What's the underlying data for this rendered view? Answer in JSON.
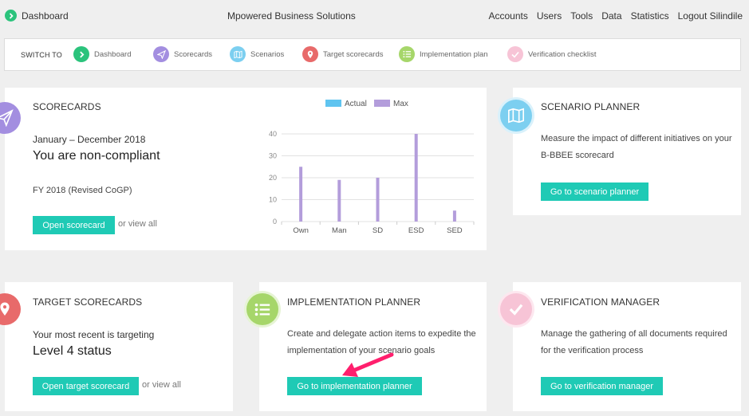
{
  "topbar": {
    "brand_label": "Dashboard",
    "company": "Mpowered Business Solutions",
    "nav": [
      "Accounts",
      "Users",
      "Tools",
      "Data",
      "Statistics",
      "Logout Silindile"
    ]
  },
  "switchbar": {
    "label": "SWITCH TO",
    "items": [
      {
        "label": "Dashboard",
        "icon": "chevron-right-icon",
        "color": "#2bc37c"
      },
      {
        "label": "Scorecards",
        "icon": "paper-plane-icon",
        "color": "#a38ee0"
      },
      {
        "label": "Scenarios",
        "icon": "map-icon",
        "color": "#7ccff0"
      },
      {
        "label": "Target scorecards",
        "icon": "map-pin-icon",
        "color": "#e86a6a"
      },
      {
        "label": "Implementation plan",
        "icon": "list-icon",
        "color": "#a6d66a"
      },
      {
        "label": "Verification checklist",
        "icon": "check-icon",
        "color": "#f7c4d6"
      }
    ]
  },
  "scorecards": {
    "title": "SCORECARDS",
    "period": "January – December 2018",
    "status": "You are non-compliant",
    "fy": "FY 2018 (Revised CoGP)",
    "button": "Open scorecard",
    "or_view_all": "or view all"
  },
  "chart_data": {
    "type": "bar",
    "categories": [
      "Own",
      "Man",
      "SD",
      "ESD",
      "SED"
    ],
    "series": [
      {
        "name": "Actual",
        "values": [
          0,
          0,
          0,
          0,
          0
        ],
        "color": "#5fc4f0"
      },
      {
        "name": "Max",
        "values": [
          25,
          19,
          20,
          40,
          5
        ],
        "color": "#b39ddb"
      }
    ],
    "ylim": [
      0,
      40
    ],
    "yticks": [
      "0",
      "10",
      "20",
      "30",
      "40"
    ],
    "legend": "top",
    "grid": true
  },
  "scenario": {
    "title": "SCENARIO PLANNER",
    "desc_line1": "Measure the impact of different initiatives on your",
    "desc_line2": "B-BBEE scorecard",
    "button": "Go to scenario planner"
  },
  "target": {
    "title": "TARGET SCORECARDS",
    "line1": "Your most recent is targeting",
    "line2": "Level 4 status",
    "button": "Open target scorecard",
    "or_view_all": "or view all"
  },
  "implementation": {
    "title": "IMPLEMENTATION PLANNER",
    "desc_line1": "Create and delegate action items to expedite the",
    "desc_line2": "implementation of your scenario goals",
    "button": "Go to implementation planner"
  },
  "verification": {
    "title": "VERIFICATION MANAGER",
    "desc_line1": "Manage the gathering of all documents required",
    "desc_line2": "for the verification process",
    "button": "Go to verification manager"
  }
}
